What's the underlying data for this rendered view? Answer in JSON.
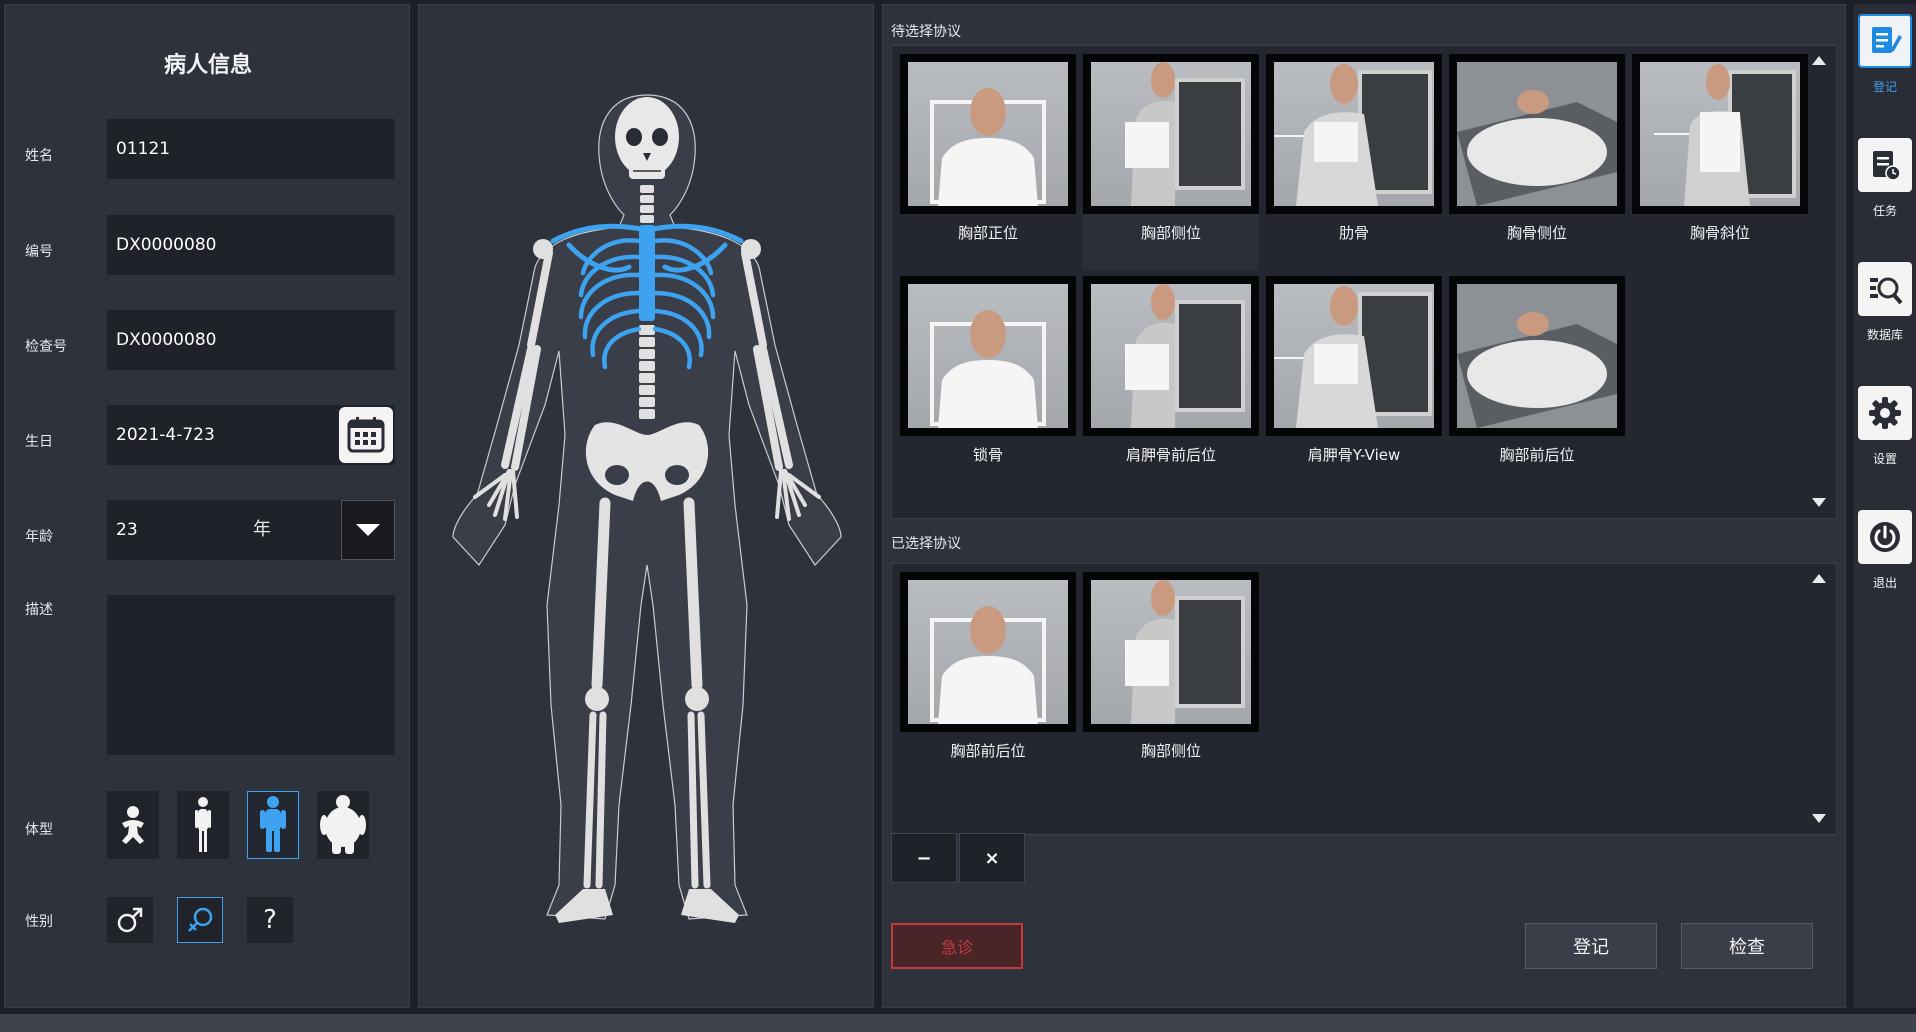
{
  "patient": {
    "title": "病人信息",
    "name_label": "姓名",
    "name_value": "01121",
    "id_label": "编号",
    "id_value": "DX0000080",
    "exam_label": "检查号",
    "exam_value": "DX0000080",
    "birth_label": "生日",
    "birth_value": "2021-4-723",
    "age_label": "年龄",
    "age_value": "23",
    "age_unit": "年",
    "desc_label": "描述",
    "body_label": "体型",
    "gender_label": "性别",
    "gender_unknown": "?"
  },
  "protocols": {
    "pending_label": "待选择协议",
    "pending": [
      "胸部正位",
      "胸部侧位",
      "肋骨",
      "胸骨侧位",
      "胸骨斜位",
      "锁骨",
      "肩胛骨前后位",
      "肩胛骨Y-View",
      "胸部前后位"
    ],
    "selected_label": "已选择协议",
    "selected": [
      "胸部前后位",
      "胸部侧位"
    ],
    "minus": "−",
    "close": "×"
  },
  "actions": {
    "red_btn": "急诊",
    "register": "登记",
    "check": "检查"
  },
  "nav": {
    "register": "登记",
    "task": "任务",
    "database": "数据库",
    "settings": "设置",
    "exit": "退出"
  },
  "colors": {
    "accent": "#3da2f0",
    "danger": "#c23b3f",
    "panel": "#2e323b"
  }
}
